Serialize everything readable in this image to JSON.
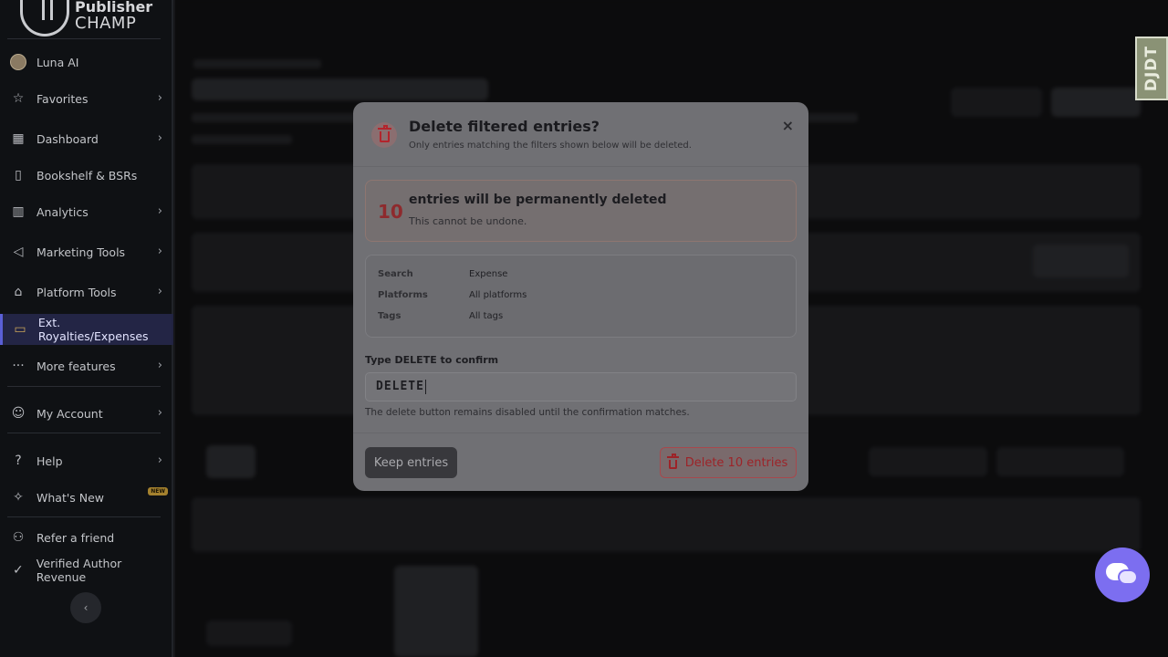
{
  "brand": {
    "line1": "Publisher",
    "line2": "CHAMP"
  },
  "sidebar": {
    "user": "Luna AI",
    "items": [
      {
        "label": "Favorites",
        "icon": "star-icon",
        "has_chevron": true
      },
      {
        "label": "Dashboard",
        "icon": "dashboard-icon",
        "has_chevron": true
      },
      {
        "label": "Bookshelf & BSRs",
        "icon": "book-icon",
        "has_chevron": false
      },
      {
        "label": "Analytics",
        "icon": "analytics-icon",
        "has_chevron": true
      },
      {
        "label": "Marketing Tools",
        "icon": "megaphone-icon",
        "has_chevron": true
      },
      {
        "label": "Platform Tools",
        "icon": "store-icon",
        "has_chevron": true
      },
      {
        "label": "Ext. Royalties/Expenses",
        "icon": "wallet-icon",
        "has_chevron": false,
        "active": true
      },
      {
        "label": "More features",
        "icon": "more-dots-icon",
        "has_chevron": true
      }
    ],
    "account": "My Account",
    "help": "Help",
    "whats_new": "What's New",
    "new_badge": "NEW",
    "refer": "Refer a friend",
    "verified": "Verified Author Revenue"
  },
  "modal": {
    "title": "Delete filtered entries?",
    "subtitle": "Only entries matching the filters shown below will be deleted.",
    "close": "×",
    "warning": {
      "count": "10",
      "title": "entries will be permanently deleted",
      "subtitle": "This cannot be undone."
    },
    "filters": [
      {
        "key": "Search",
        "value": "Expense"
      },
      {
        "key": "Platforms",
        "value": "All platforms"
      },
      {
        "key": "Tags",
        "value": "All tags"
      }
    ],
    "confirm_label": "Type DELETE to confirm",
    "confirm_value": "DELETE",
    "confirm_help": "The delete button remains disabled until the confirmation matches.",
    "keep_button": "Keep entries",
    "delete_button": "Delete 10 entries"
  },
  "debug_toolbar": {
    "label": "DJDT"
  },
  "colors": {
    "accent": "#7c6ef0",
    "danger": "#b3242c",
    "active_nav": "#232545"
  }
}
